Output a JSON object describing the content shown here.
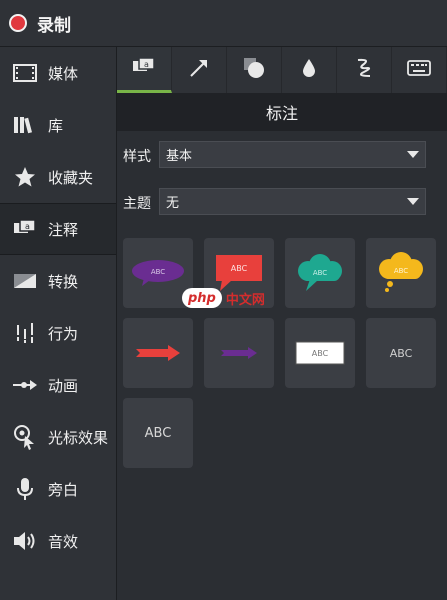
{
  "app": {
    "title": "录制",
    "record_color": "#e0383e"
  },
  "sidebar": {
    "items": [
      {
        "label": "媒体",
        "icon": "film-icon"
      },
      {
        "label": "库",
        "icon": "books-icon"
      },
      {
        "label": "收藏夹",
        "icon": "star-icon"
      },
      {
        "label": "注释",
        "icon": "callout-icon",
        "active": true
      },
      {
        "label": "转换",
        "icon": "transition-icon"
      },
      {
        "label": "行为",
        "icon": "behavior-icon"
      },
      {
        "label": "动画",
        "icon": "animation-icon"
      },
      {
        "label": "光标效果",
        "icon": "cursor-effect-icon"
      },
      {
        "label": "旁白",
        "icon": "microphone-icon"
      },
      {
        "label": "音效",
        "icon": "speaker-icon"
      }
    ]
  },
  "tabs": [
    {
      "icon": "callout-icon",
      "active": true
    },
    {
      "icon": "arrow-icon"
    },
    {
      "icon": "shape-icon"
    },
    {
      "icon": "blur-drop-icon"
    },
    {
      "icon": "sketch-motion-icon"
    },
    {
      "icon": "keyboard-icon"
    }
  ],
  "panel": {
    "title": "标注",
    "style_label": "样式",
    "style_value": "基本",
    "theme_label": "主题",
    "theme_value": "无"
  },
  "callouts": [
    {
      "name": "oval-callout",
      "text": "ABC",
      "color": "#6a2d91"
    },
    {
      "name": "rectangle-callout",
      "text": "ABC",
      "color": "#e8403c"
    },
    {
      "name": "cloud-callout-teal",
      "text": "ABC",
      "color": "#1ea890"
    },
    {
      "name": "cloud-callout-yellow",
      "text": "ABC",
      "color": "#f4b81c"
    },
    {
      "name": "arrow-callout-red",
      "text": "",
      "color": "#e8403c"
    },
    {
      "name": "arrow-callout-purple",
      "text": "",
      "color": "#6a2d91"
    },
    {
      "name": "box-callout-white",
      "text": "ABC",
      "color": "#ffffff"
    },
    {
      "name": "text-callout-small",
      "text": "ABC",
      "color": "#b0b0b0"
    },
    {
      "name": "text-callout-large",
      "text": "ABC",
      "color": "#d0d0d0"
    }
  ],
  "watermark": {
    "badge": "php",
    "text": "中文网"
  }
}
